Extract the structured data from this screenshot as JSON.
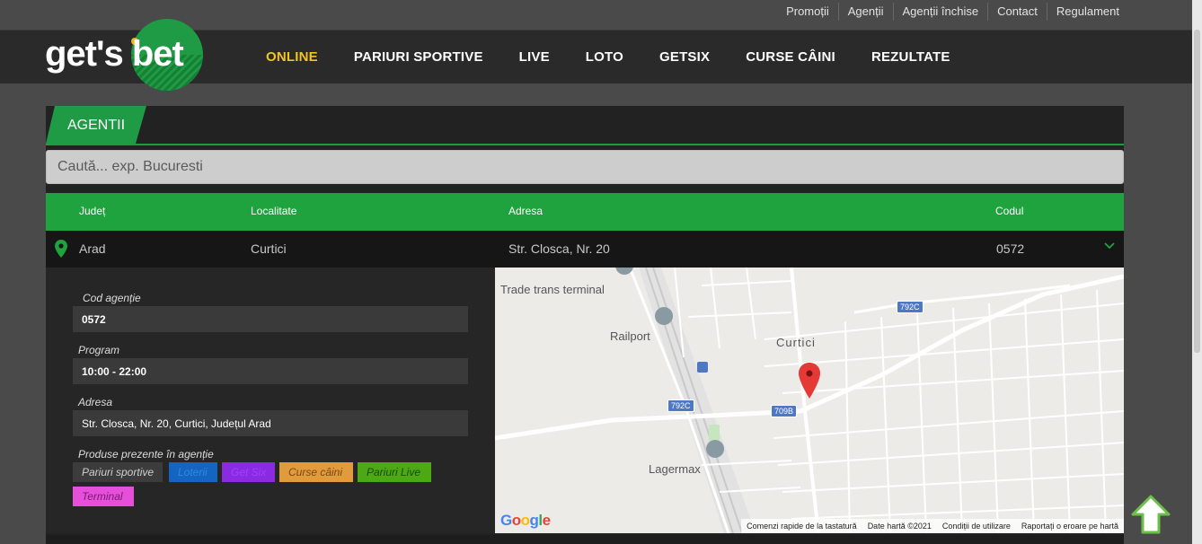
{
  "top_links": [
    "Promoții",
    "Agenții",
    "Agenții închise",
    "Contact",
    "Regulament"
  ],
  "logo": {
    "text": "get's bet"
  },
  "nav": {
    "items": [
      {
        "label": "ONLINE",
        "active": true
      },
      {
        "label": "PARIURI SPORTIVE",
        "active": false
      },
      {
        "label": "LIVE",
        "active": false
      },
      {
        "label": "LOTO",
        "active": false
      },
      {
        "label": "GETSIX",
        "active": false
      },
      {
        "label": "CURSE CÂINI",
        "active": false
      },
      {
        "label": "REZULTATE",
        "active": false
      }
    ]
  },
  "panel": {
    "title": "AGENTII",
    "search_placeholder": "Caută... exp. Bucuresti"
  },
  "table": {
    "headers": {
      "judet": "Județ",
      "localitate": "Localitate",
      "adresa": "Adresa",
      "codul": "Codul"
    },
    "row": {
      "judet": "Arad",
      "localitate": "Curtici",
      "adresa": "Str. Closca, Nr. 20",
      "codul": "0572"
    }
  },
  "details": {
    "cod_label": "Cod agenție",
    "cod_value": "0572",
    "program_label": "Program",
    "program_value": "10:00 - 22:00",
    "adresa_label": "Adresa",
    "adresa_value": "Str. Closca, Nr. 20, Curtici, Județul Arad",
    "produse_label": "Produse prezente în agenție",
    "products": [
      {
        "label": "Pariuri sportive",
        "color": "#3c3c3c",
        "text_color": "#cfcfcf"
      },
      {
        "label": "Loterii",
        "color": "#1565c0",
        "text_color": "#1e88e5"
      },
      {
        "label": "Get Six",
        "color": "#8a2be2",
        "text_color": "#9b30ff"
      },
      {
        "label": "Curse câini",
        "color": "#e19a3c",
        "text_color": "#7a4a10"
      },
      {
        "label": "Pariuri Live",
        "color": "#4ca815",
        "text_color": "#1c4c05"
      },
      {
        "label": "Terminal",
        "color": "#e54fd9",
        "text_color": "#7a1a70"
      }
    ]
  },
  "map": {
    "places": [
      "Trade trans terminal",
      "Railport",
      "Curtici",
      "Lagermax"
    ],
    "road_badges": [
      "792C",
      "792C",
      "709B"
    ],
    "google_label": "Google",
    "footer": [
      "Comenzi rapide de la tastatură",
      "Date hartă ©2021",
      "Condiții de utilizare",
      "Raportați o eroare pe hartă"
    ]
  },
  "colors": {
    "accent_green": "#1ea33f",
    "active_nav": "#f3c323"
  }
}
